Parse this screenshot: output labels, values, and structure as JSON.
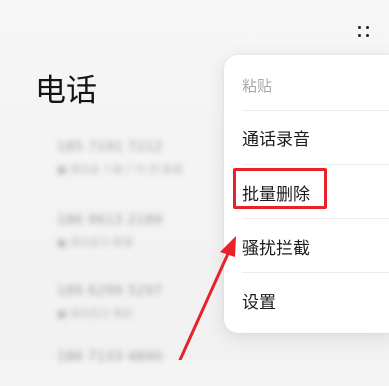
{
  "header": {
    "title": "电话"
  },
  "call_list": [
    {
      "number": "185 7191 7212",
      "meta": "■ 湖北省 十堰 广州 四 联通"
    },
    {
      "number": "186 9613 2189",
      "meta": "■ 湖北武汉 联通"
    },
    {
      "number": "189 6299 5297",
      "meta": "■ 湖北武汉 电信"
    },
    {
      "number": "186 7133 4890",
      "meta": ""
    }
  ],
  "overflow_menu": {
    "items": [
      {
        "label": "粘贴",
        "enabled": false
      },
      {
        "label": "通话录音",
        "enabled": true
      },
      {
        "label": "批量删除",
        "enabled": true,
        "highlighted": true
      },
      {
        "label": "骚扰拦截",
        "enabled": true
      },
      {
        "label": "设置",
        "enabled": true
      }
    ]
  },
  "annotation": {
    "highlight_color": "#e8212a",
    "arrow_color": "#e8212a"
  },
  "icons": {
    "more": "more-vertical-icon"
  }
}
